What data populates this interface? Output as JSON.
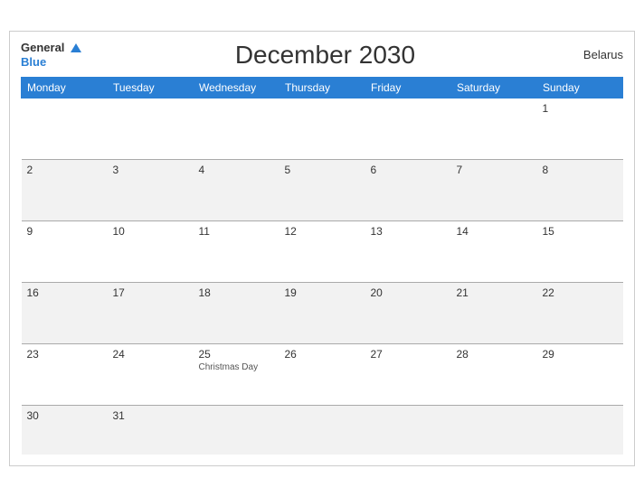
{
  "header": {
    "title": "December 2030",
    "country": "Belarus",
    "logo_general": "General",
    "logo_blue": "Blue"
  },
  "weekdays": [
    "Monday",
    "Tuesday",
    "Wednesday",
    "Thursday",
    "Friday",
    "Saturday",
    "Sunday"
  ],
  "weeks": [
    [
      {
        "day": "",
        "event": ""
      },
      {
        "day": "",
        "event": ""
      },
      {
        "day": "",
        "event": ""
      },
      {
        "day": "",
        "event": ""
      },
      {
        "day": "",
        "event": ""
      },
      {
        "day": "",
        "event": ""
      },
      {
        "day": "1",
        "event": ""
      }
    ],
    [
      {
        "day": "2",
        "event": ""
      },
      {
        "day": "3",
        "event": ""
      },
      {
        "day": "4",
        "event": ""
      },
      {
        "day": "5",
        "event": ""
      },
      {
        "day": "6",
        "event": ""
      },
      {
        "day": "7",
        "event": ""
      },
      {
        "day": "8",
        "event": ""
      }
    ],
    [
      {
        "day": "9",
        "event": ""
      },
      {
        "day": "10",
        "event": ""
      },
      {
        "day": "11",
        "event": ""
      },
      {
        "day": "12",
        "event": ""
      },
      {
        "day": "13",
        "event": ""
      },
      {
        "day": "14",
        "event": ""
      },
      {
        "day": "15",
        "event": ""
      }
    ],
    [
      {
        "day": "16",
        "event": ""
      },
      {
        "day": "17",
        "event": ""
      },
      {
        "day": "18",
        "event": ""
      },
      {
        "day": "19",
        "event": ""
      },
      {
        "day": "20",
        "event": ""
      },
      {
        "day": "21",
        "event": ""
      },
      {
        "day": "22",
        "event": ""
      }
    ],
    [
      {
        "day": "23",
        "event": ""
      },
      {
        "day": "24",
        "event": ""
      },
      {
        "day": "25",
        "event": "Christmas Day"
      },
      {
        "day": "26",
        "event": ""
      },
      {
        "day": "27",
        "event": ""
      },
      {
        "day": "28",
        "event": ""
      },
      {
        "day": "29",
        "event": ""
      }
    ],
    [
      {
        "day": "30",
        "event": ""
      },
      {
        "day": "31",
        "event": ""
      },
      {
        "day": "",
        "event": ""
      },
      {
        "day": "",
        "event": ""
      },
      {
        "day": "",
        "event": ""
      },
      {
        "day": "",
        "event": ""
      },
      {
        "day": "",
        "event": ""
      }
    ]
  ]
}
